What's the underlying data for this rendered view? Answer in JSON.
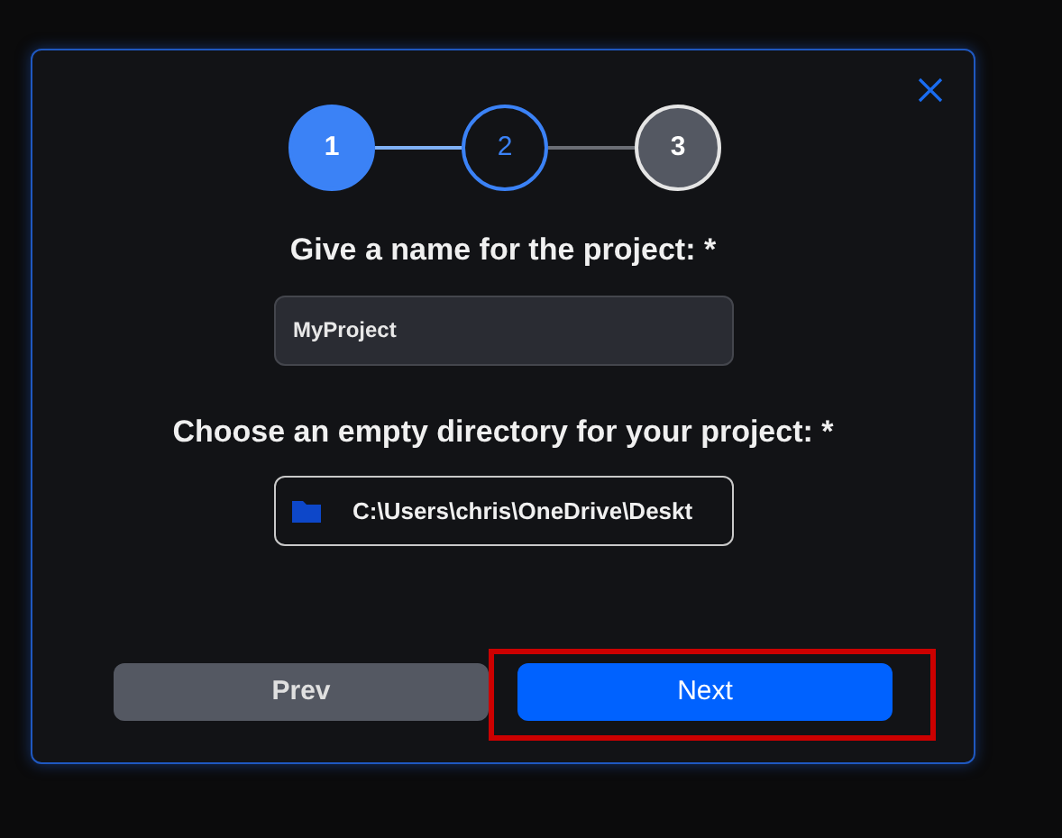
{
  "steps": [
    {
      "label": "1",
      "selected": true,
      "disabled": false
    },
    {
      "label": "2",
      "selected": false,
      "disabled": false
    },
    {
      "label": "3",
      "selected": false,
      "disabled": true
    }
  ],
  "name_field": {
    "label": "Give a name for the project: *",
    "value": "MyProject"
  },
  "directory_field": {
    "label": "Choose an empty directory for your project: *",
    "value": "C:\\Users\\chris\\OneDrive\\Deskt"
  },
  "buttons": [
    {
      "label": "Prev",
      "kind": "secondary",
      "highlighted": false
    },
    {
      "label": "Next",
      "kind": "primary",
      "highlighted": true
    }
  ]
}
